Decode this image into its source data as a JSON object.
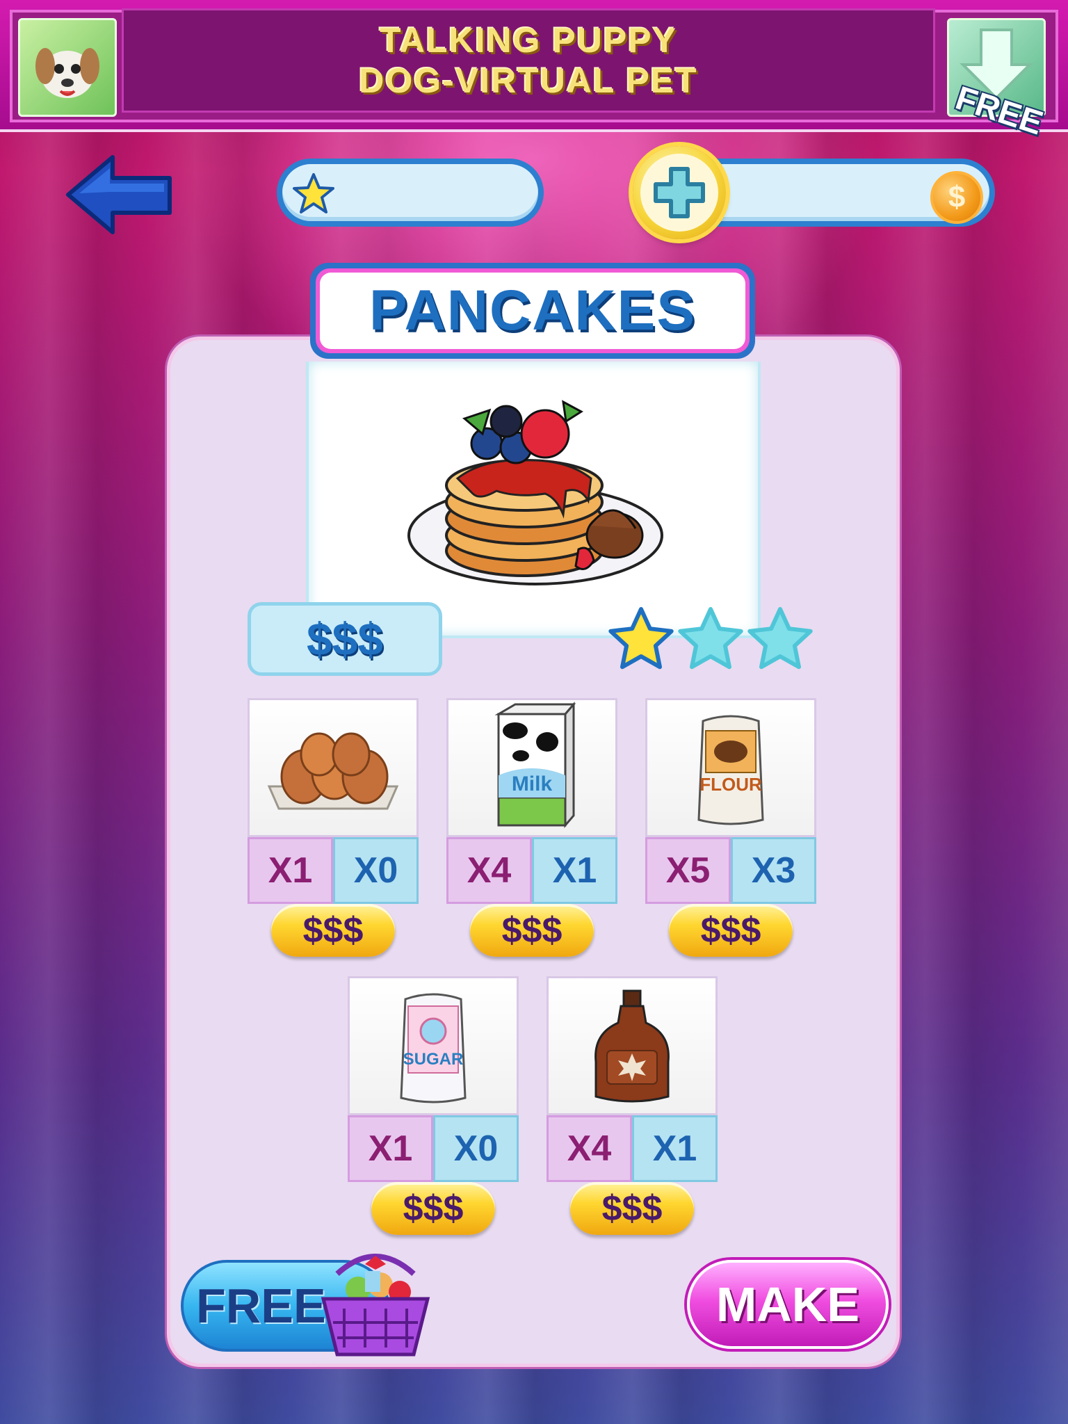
{
  "ad": {
    "title_line1": "TALKING PUPPY",
    "title_line2": "DOG-VIRTUAL PET",
    "free_tag": "FREE",
    "app_icon": "puppy-icon",
    "download_icon": "download-arrow-icon"
  },
  "header": {
    "back_icon": "back-arrow-icon",
    "stars_icon": "star-icon",
    "stars_value": "",
    "plus_icon": "plus-icon",
    "coins_icon": "coin-icon",
    "coins_symbol": "$",
    "coins_value": ""
  },
  "recipe": {
    "title": "PANCAKES",
    "image": "pancakes-with-berries",
    "price": "$$$",
    "rating": 1,
    "rating_max": 3
  },
  "ingredients": [
    {
      "name": "eggs",
      "need": "X1",
      "have": "X0",
      "buy": "$$$"
    },
    {
      "name": "milk",
      "need": "X4",
      "have": "X1",
      "buy": "$$$"
    },
    {
      "name": "flour",
      "need": "X5",
      "have": "X3",
      "buy": "$$$"
    },
    {
      "name": "sugar",
      "need": "X1",
      "have": "X0",
      "buy": "$$$"
    },
    {
      "name": "maple-syrup",
      "need": "X4",
      "have": "X1",
      "buy": "$$$"
    }
  ],
  "labels": {
    "milk": "Milk",
    "flour": "FLOUR",
    "sugar": "SUGAR"
  },
  "buttons": {
    "free": "FREE",
    "make": "MAKE"
  },
  "colors": {
    "accent_blue": "#1e6fc0",
    "accent_pink": "#f05ad4",
    "gold": "#ffd630"
  }
}
